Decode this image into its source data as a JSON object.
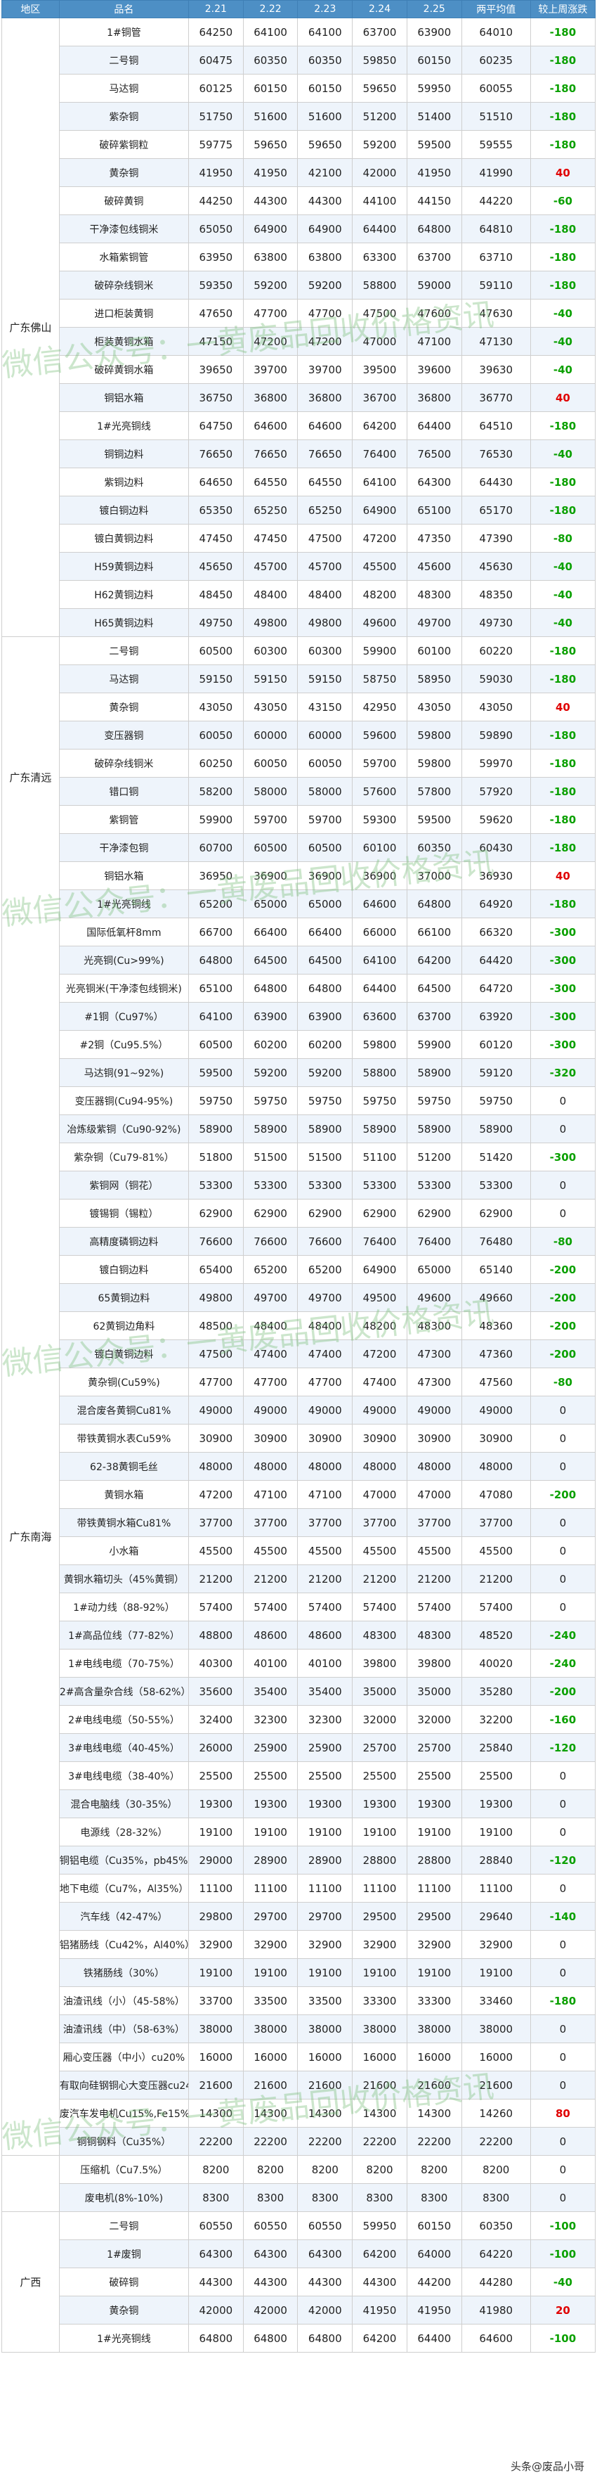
{
  "columns": [
    "地区",
    "品名",
    "2.21",
    "2.22",
    "2.23",
    "2.24",
    "2.25",
    "两平均值",
    "较上周涨跌"
  ],
  "groups": [
    {
      "region": "广东佛山",
      "rows": [
        [
          "1#铜管",
          "64250",
          "64100",
          "64100",
          "63700",
          "63900",
          "64010",
          "-180"
        ],
        [
          "二号铜",
          "60475",
          "60350",
          "60350",
          "59850",
          "60150",
          "60235",
          "-180"
        ],
        [
          "马达铜",
          "60125",
          "60150",
          "60150",
          "59650",
          "59950",
          "60055",
          "-180"
        ],
        [
          "紫杂铜",
          "51750",
          "51600",
          "51600",
          "51200",
          "51400",
          "51510",
          "-180"
        ],
        [
          "破碎紫铜粒",
          "59775",
          "59650",
          "59650",
          "59200",
          "59500",
          "59555",
          "-180"
        ],
        [
          "黄杂铜",
          "41950",
          "41950",
          "42100",
          "42000",
          "41950",
          "41990",
          "40"
        ],
        [
          "破碎黄铜",
          "44250",
          "44300",
          "44300",
          "44100",
          "44150",
          "44220",
          "-60"
        ],
        [
          "干净漆包线铜米",
          "65050",
          "64900",
          "64900",
          "64400",
          "64800",
          "64810",
          "-180"
        ],
        [
          "水箱紫铜管",
          "63950",
          "63800",
          "63800",
          "63300",
          "63700",
          "63710",
          "-180"
        ],
        [
          "破碎杂线铜米",
          "59350",
          "59200",
          "59200",
          "58800",
          "59000",
          "59110",
          "-180"
        ],
        [
          "进口柜装黄铜",
          "47650",
          "47700",
          "47700",
          "47500",
          "47600",
          "47630",
          "-40"
        ],
        [
          "柜装黄铜水箱",
          "47150",
          "47200",
          "47200",
          "47000",
          "47100",
          "47130",
          "-40"
        ],
        [
          "破碎黄铜水箱",
          "39650",
          "39700",
          "39700",
          "39500",
          "39600",
          "39630",
          "-40"
        ],
        [
          "铜铝水箱",
          "36750",
          "36800",
          "36800",
          "36700",
          "36800",
          "36770",
          "40"
        ],
        [
          "1#光亮铜线",
          "64750",
          "64600",
          "64600",
          "64200",
          "64400",
          "64510",
          "-180"
        ],
        [
          "铜铜边料",
          "76650",
          "76650",
          "76650",
          "76400",
          "76500",
          "76530",
          "-40"
        ],
        [
          "紫铜边料",
          "64650",
          "64550",
          "64550",
          "64100",
          "64300",
          "64430",
          "-180"
        ],
        [
          "镀白铜边料",
          "65350",
          "65250",
          "65250",
          "64900",
          "65100",
          "65170",
          "-180"
        ],
        [
          "镀白黄铜边料",
          "47450",
          "47450",
          "47500",
          "47200",
          "47350",
          "47390",
          "-80"
        ],
        [
          "H59黄铜边料",
          "45650",
          "45700",
          "45700",
          "45500",
          "45600",
          "45630",
          "-40"
        ],
        [
          "H62黄铜边料",
          "48450",
          "48400",
          "48400",
          "48200",
          "48300",
          "48350",
          "-40"
        ],
        [
          "H65黄铜边料",
          "49750",
          "49800",
          "49800",
          "49600",
          "49700",
          "49730",
          "-40"
        ]
      ]
    },
    {
      "region": "广东清远",
      "rows": [
        [
          "二号铜",
          "60500",
          "60300",
          "60300",
          "59900",
          "60100",
          "60220",
          "-180"
        ],
        [
          "马达铜",
          "59150",
          "59150",
          "59150",
          "58750",
          "58950",
          "59030",
          "-180"
        ],
        [
          "黄杂铜",
          "43050",
          "43050",
          "43150",
          "42950",
          "43050",
          "43050",
          "40"
        ],
        [
          "变压器铜",
          "60050",
          "60000",
          "60000",
          "59600",
          "59800",
          "59890",
          "-180"
        ],
        [
          "破碎杂线铜米",
          "60250",
          "60050",
          "60050",
          "59700",
          "59800",
          "59970",
          "-180"
        ],
        [
          "错口铜",
          "58200",
          "58000",
          "58000",
          "57600",
          "57800",
          "57920",
          "-180"
        ],
        [
          "紫铜管",
          "59900",
          "59700",
          "59700",
          "59300",
          "59500",
          "59620",
          "-180"
        ],
        [
          "干净漆包铜",
          "60700",
          "60500",
          "60500",
          "60100",
          "60350",
          "60430",
          "-180"
        ],
        [
          "铜铝水箱",
          "36950",
          "36900",
          "36900",
          "36900",
          "37000",
          "36930",
          "40"
        ],
        [
          "1#光亮铜线",
          "65200",
          "65000",
          "65000",
          "64600",
          "64800",
          "64920",
          "-180"
        ]
      ]
    },
    {
      "region": "广东南海",
      "rows": [
        [
          "国际低氧杆8mm",
          "66700",
          "66400",
          "66400",
          "66000",
          "66100",
          "66320",
          "-300"
        ],
        [
          "光亮铜(Cu>99%)",
          "64800",
          "64500",
          "64500",
          "64100",
          "64200",
          "64420",
          "-300"
        ],
        [
          "光亮铜米(干净漆包线铜米)",
          "65100",
          "64800",
          "64800",
          "64400",
          "64500",
          "64720",
          "-300"
        ],
        [
          "#1铜（Cu97%）",
          "64100",
          "63900",
          "63900",
          "63600",
          "63700",
          "63920",
          "-300"
        ],
        [
          "#2铜（Cu95.5%）",
          "60500",
          "60200",
          "60200",
          "59800",
          "59900",
          "60120",
          "-300"
        ],
        [
          "马达铜(91~92%)",
          "59500",
          "59200",
          "59200",
          "58800",
          "58900",
          "59120",
          "-320"
        ],
        [
          "变压器铜(Cu94-95%)",
          "59750",
          "59750",
          "59750",
          "59750",
          "59750",
          "59750",
          "0"
        ],
        [
          "冶炼级紫铜（Cu90-92%)",
          "58900",
          "58900",
          "58900",
          "58900",
          "58900",
          "58900",
          "0"
        ],
        [
          "紫杂铜（Cu79-81%）",
          "51800",
          "51500",
          "51500",
          "51100",
          "51200",
          "51420",
          "-300"
        ],
        [
          "紫铜网（铜花）",
          "53300",
          "53300",
          "53300",
          "53300",
          "53300",
          "53300",
          "0"
        ],
        [
          "镀锡铜（锡粒）",
          "62900",
          "62900",
          "62900",
          "62900",
          "62900",
          "62900",
          "0"
        ],
        [
          "高精度磷铜边料",
          "76600",
          "76600",
          "76600",
          "76400",
          "76400",
          "76480",
          "-80"
        ],
        [
          "镀白铜边料",
          "65400",
          "65200",
          "65200",
          "64900",
          "65000",
          "65140",
          "-200"
        ],
        [
          "65黄铜边料",
          "49800",
          "49700",
          "49700",
          "49500",
          "49600",
          "49660",
          "-200"
        ],
        [
          "62黄铜边角料",
          "48500",
          "48400",
          "48400",
          "48200",
          "48300",
          "48360",
          "-200"
        ],
        [
          "镀白黄铜边料",
          "47500",
          "47400",
          "47400",
          "47200",
          "47300",
          "47360",
          "-200"
        ],
        [
          "黄杂铜(Cu59%)",
          "47700",
          "47700",
          "47700",
          "47400",
          "47300",
          "47560",
          "-80"
        ],
        [
          "混合废各黄铜Cu81%",
          "49000",
          "49000",
          "49000",
          "49000",
          "49000",
          "49000",
          "0"
        ],
        [
          "带铁黄铜水表Cu59%",
          "30900",
          "30900",
          "30900",
          "30900",
          "30900",
          "30900",
          "0"
        ],
        [
          "62-38黄铜毛丝",
          "48000",
          "48000",
          "48000",
          "48000",
          "48000",
          "48000",
          "0"
        ],
        [
          "黄铜水箱",
          "47200",
          "47100",
          "47100",
          "47000",
          "47000",
          "47080",
          "-200"
        ],
        [
          "带铁黄铜水箱Cu81%",
          "37700",
          "37700",
          "37700",
          "37700",
          "37700",
          "37700",
          "0"
        ],
        [
          "小水箱",
          "45500",
          "45500",
          "45500",
          "45500",
          "45500",
          "45500",
          "0"
        ],
        [
          "黄铜水箱切头（45%黄铜）",
          "21200",
          "21200",
          "21200",
          "21200",
          "21200",
          "21200",
          "0"
        ],
        [
          "1#动力线（88-92%）",
          "57400",
          "57400",
          "57400",
          "57400",
          "57400",
          "57400",
          "0"
        ],
        [
          "1#高品位线（77-82%）",
          "48800",
          "48600",
          "48600",
          "48300",
          "48300",
          "48520",
          "-240"
        ],
        [
          "1#电线电缆（70-75%）",
          "40300",
          "40100",
          "40100",
          "39800",
          "39800",
          "40020",
          "-240"
        ],
        [
          "2#高含量杂合线（58-62%）",
          "35600",
          "35400",
          "35400",
          "35000",
          "35000",
          "35280",
          "-200"
        ],
        [
          "2#电线电缆（50-55%）",
          "32400",
          "32300",
          "32300",
          "32000",
          "32000",
          "32200",
          "-160"
        ],
        [
          "3#电线电缆（40-45%）",
          "26000",
          "25900",
          "25900",
          "25700",
          "25700",
          "25840",
          "-120"
        ],
        [
          "3#电线电缆（38-40%）",
          "25500",
          "25500",
          "25500",
          "25500",
          "25500",
          "25500",
          "0"
        ],
        [
          "混合电脑线（30-35%）",
          "19300",
          "19300",
          "19300",
          "19300",
          "19300",
          "19300",
          "0"
        ],
        [
          "电源线（28-32%）",
          "19100",
          "19100",
          "19100",
          "19100",
          "19100",
          "19100",
          "0"
        ],
        [
          "铜铝电缆（Cu35%，pb45%）",
          "29000",
          "28900",
          "28900",
          "28800",
          "28800",
          "28840",
          "-120"
        ],
        [
          "地下电缆（Cu7%，Al35%）",
          "11100",
          "11100",
          "11100",
          "11100",
          "11100",
          "11100",
          "0"
        ],
        [
          "汽车线（42-47%）",
          "29800",
          "29700",
          "29700",
          "29500",
          "29500",
          "29640",
          "-140"
        ],
        [
          "铝猪肠线（Cu42%，Al40%）",
          "32900",
          "32900",
          "32900",
          "32900",
          "32900",
          "32900",
          "0"
        ],
        [
          "铁猪肠线（30%）",
          "19100",
          "19100",
          "19100",
          "19100",
          "19100",
          "19100",
          "0"
        ],
        [
          "油渣讯线（小）（45-58%）",
          "33700",
          "33500",
          "33500",
          "33300",
          "33300",
          "33460",
          "-180"
        ],
        [
          "油渣讯线（中）（58-63%）",
          "38000",
          "38000",
          "38000",
          "38000",
          "38000",
          "38000",
          "0"
        ],
        [
          "厢心变压器（中小）cu20%",
          "16000",
          "16000",
          "16000",
          "16000",
          "16000",
          "16000",
          "0"
        ],
        [
          "有取向硅钢铜心大变压器cu24%",
          "21600",
          "21600",
          "21600",
          "21600",
          "21600",
          "21600",
          "0"
        ],
        [
          "废汽车发电机Cu15%,Fe15%",
          "14300",
          "14300",
          "14300",
          "14300",
          "14300",
          "14260",
          "80"
        ],
        [
          "铜铜钢料（Cu35%）",
          "22200",
          "22200",
          "22200",
          "22200",
          "22200",
          "22200",
          "0"
        ]
      ]
    },
    {
      "region": "",
      "rows": [
        [
          "压缩机（Cu7.5%）",
          "8200",
          "8200",
          "8200",
          "8200",
          "8200",
          "8200",
          "0"
        ],
        [
          "废电机(8%-10%)",
          "8300",
          "8300",
          "8300",
          "8300",
          "8300",
          "8300",
          "0"
        ]
      ]
    },
    {
      "region": "广西",
      "rows": [
        [
          "二号铜",
          "60550",
          "60550",
          "60550",
          "59950",
          "60150",
          "60350",
          "-100"
        ],
        [
          "1#废铜",
          "64300",
          "64300",
          "64300",
          "64200",
          "64000",
          "64220",
          "-100"
        ],
        [
          "破碎铜",
          "44300",
          "44300",
          "44300",
          "44300",
          "44200",
          "44280",
          "-40"
        ],
        [
          "黄杂铜",
          "42000",
          "42000",
          "42000",
          "41950",
          "41950",
          "41980",
          "20"
        ],
        [
          "1#光亮铜线",
          "64800",
          "64800",
          "64800",
          "64200",
          "64400",
          "64600",
          "-100"
        ]
      ]
    }
  ],
  "watermark": "微信公众号：一黄废品回收价格资讯",
  "footer": "头条@废品小哥",
  "colors": {
    "header": "#4d8fc5",
    "up": "#e00000",
    "down": "#0aa000",
    "watermark": "#78be78"
  }
}
